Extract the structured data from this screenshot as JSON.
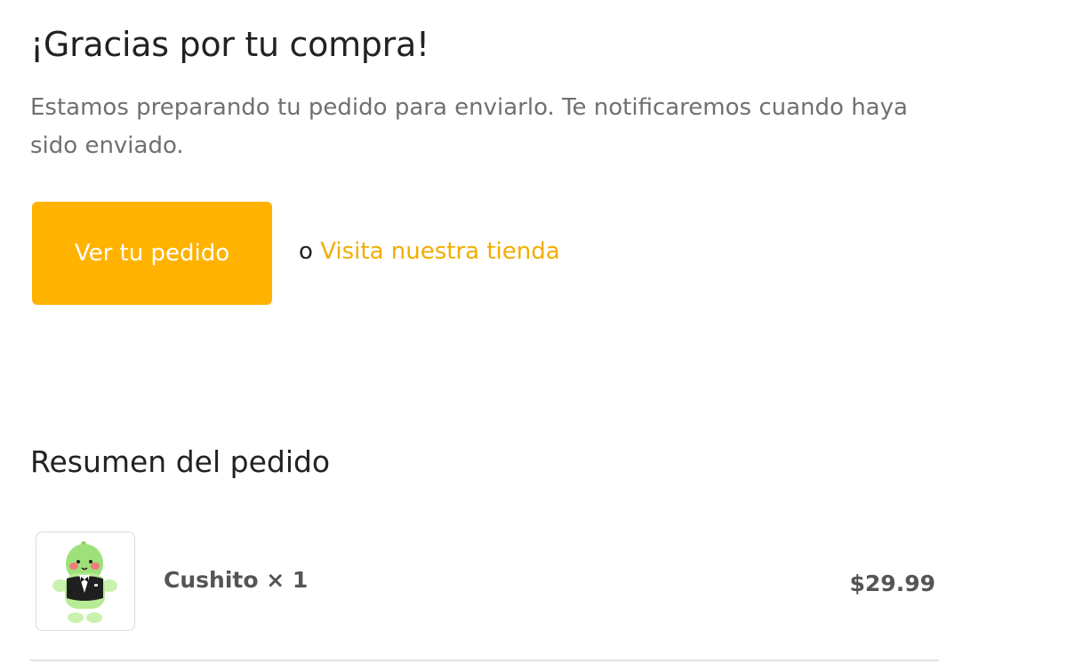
{
  "confirmation": {
    "title": "¡Gracias por tu compra!",
    "message": "Estamos preparando tu pedido para enviarlo. Te notificaremos cuando haya sido enviado."
  },
  "actions": {
    "view_order_label": "Ver tu pedido",
    "or_text": "o",
    "store_link_label": "Visita nuestra tienda"
  },
  "summary": {
    "heading": "Resumen del pedido",
    "items": [
      {
        "name": "Cushito",
        "quantity_text": "× 1",
        "price": "$29.99",
        "image": "plush-toy-image"
      }
    ]
  },
  "colors": {
    "accent": "#ffb300",
    "link": "#f2ad00",
    "text_primary": "#222222",
    "text_secondary": "#707070"
  }
}
